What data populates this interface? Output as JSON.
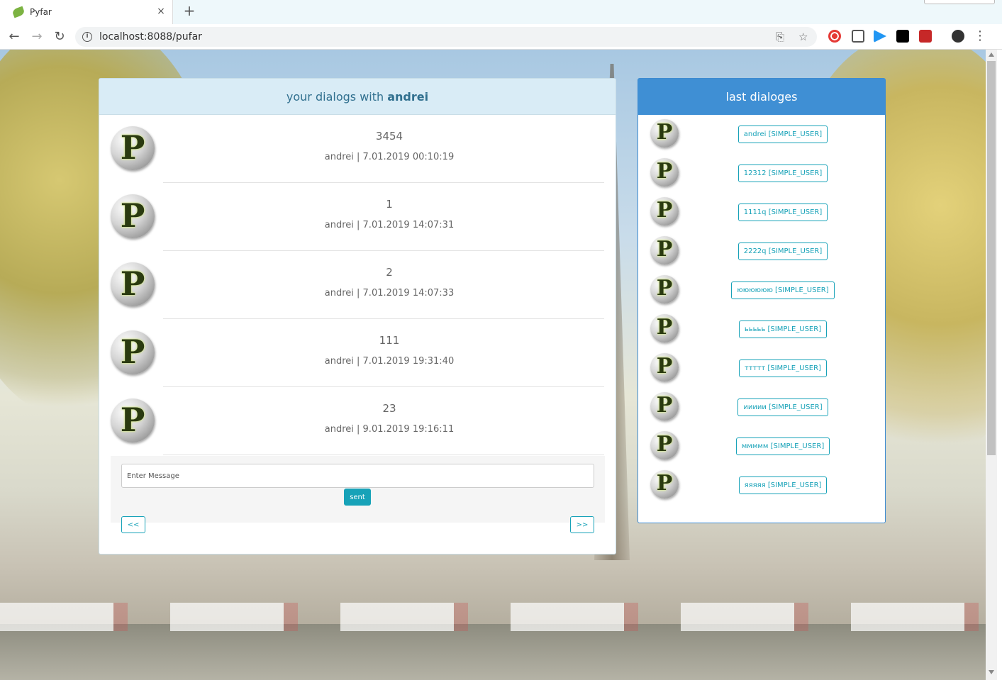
{
  "browser": {
    "tab_title": "Pyfar",
    "tab_close": "×",
    "new_tab": "+",
    "url": "localhost:8088/pufar",
    "back": "←",
    "forward": "→",
    "reload": "↻",
    "translate_icon": "⎘",
    "star_icon": "☆",
    "menu_icon": "⋮"
  },
  "dialogs": {
    "header_prefix": "your dialogs with ",
    "header_user": "andrei",
    "messages": [
      {
        "text": "3454",
        "meta": "andrei | 7.01.2019 00:10:19"
      },
      {
        "text": "1",
        "meta": "andrei | 7.01.2019 14:07:31"
      },
      {
        "text": "2",
        "meta": "andrei | 7.01.2019 14:07:33"
      },
      {
        "text": "111",
        "meta": "andrei | 7.01.2019 19:31:40"
      },
      {
        "text": "23",
        "meta": "andrei | 9.01.2019 19:16:11"
      }
    ],
    "avatar_letter": "P",
    "input_placeholder": "Enter Message",
    "send_label": "sent",
    "prev_label": "<<",
    "next_label": ">>"
  },
  "last_dialoges": {
    "header": "last dialoges",
    "items": [
      {
        "label": "andrei [SIMPLE_USER]"
      },
      {
        "label": "12312 [SIMPLE_USER]"
      },
      {
        "label": "1111q [SIMPLE_USER]"
      },
      {
        "label": "2222q [SIMPLE_USER]"
      },
      {
        "label": "юююююю [SIMPLE_USER]"
      },
      {
        "label": "ььььь [SIMPLE_USER]"
      },
      {
        "label": "ттттт [SIMPLE_USER]"
      },
      {
        "label": "иииии [SIMPLE_USER]"
      },
      {
        "label": "ммммм [SIMPLE_USER]"
      },
      {
        "label": "яяяяя [SIMPLE_USER]"
      }
    ]
  },
  "colors": {
    "accent": "#17a2b8",
    "header_blue": "#3f8fd4",
    "header_light": "#d9ecf6"
  }
}
